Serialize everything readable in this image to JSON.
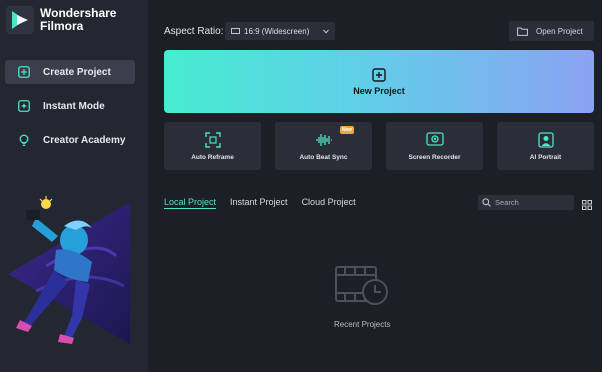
{
  "app": {
    "brand_line1": "Wondershare",
    "brand_line2": "Filmora"
  },
  "sidebar": {
    "items": [
      {
        "label": "Create Project",
        "icon": "plus-square-icon",
        "active": true
      },
      {
        "label": "Instant Mode",
        "icon": "sparkle-square-icon",
        "active": false
      },
      {
        "label": "Creator Academy",
        "icon": "lightbulb-icon",
        "active": false
      }
    ]
  },
  "toolbar": {
    "aspect_label": "Aspect Ratio:",
    "aspect_value": "16:9 (Widescreen)",
    "open_project": "Open Project"
  },
  "new_project": {
    "label": "New Project"
  },
  "tools": [
    {
      "label": "Auto Reframe",
      "icon": "reframe-icon"
    },
    {
      "label": "Auto Beat Sync",
      "icon": "waveform-icon",
      "badge": "New"
    },
    {
      "label": "Screen Recorder",
      "icon": "screen-record-icon"
    },
    {
      "label": "AI Portrait",
      "icon": "portrait-icon"
    }
  ],
  "tabs": [
    {
      "label": "Local Project",
      "active": true
    },
    {
      "label": "Instant Project",
      "active": false
    },
    {
      "label": "Cloud Project",
      "active": false
    }
  ],
  "search": {
    "placeholder": "Search"
  },
  "empty_state": {
    "label": "Recent Projects"
  },
  "colors": {
    "accent": "#56e0c8",
    "badge": "#f0a63c",
    "background": "#1c1f26",
    "sidebar": "#232731"
  }
}
